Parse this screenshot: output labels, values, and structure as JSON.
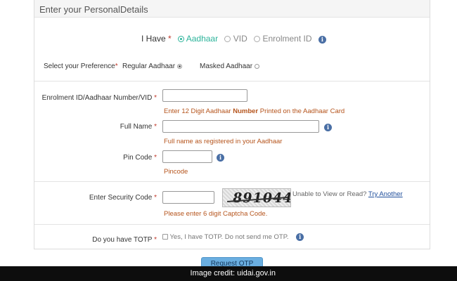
{
  "panel": {
    "title": "Enter your PersonalDetails"
  },
  "have": {
    "label": "I Have",
    "required": "*",
    "options": [
      {
        "label": "Aadhaar",
        "selected": true
      },
      {
        "label": "VID",
        "selected": false
      },
      {
        "label": "Enrolment ID",
        "selected": false
      }
    ]
  },
  "preference": {
    "label": "Select your Preference",
    "required": "*",
    "options": [
      {
        "label": "Regular Aadhaar",
        "selected": true
      },
      {
        "label": "Masked Aadhaar",
        "selected": false
      }
    ]
  },
  "id_field": {
    "label": "Enrolment ID/Aadhaar Number/VID",
    "required": "*",
    "value": "",
    "hint_before": "Enter 12 Digit Aadhaar ",
    "hint_bold": "Number",
    "hint_after": " Printed on the Aadhaar Card"
  },
  "name_field": {
    "label": "Full Name",
    "required": "*",
    "value": "",
    "hint": "Full name as registered in your Aadhaar"
  },
  "pin_field": {
    "label": "Pin Code",
    "required": "*",
    "value": "",
    "hint": "Pincode"
  },
  "security": {
    "label": "Enter Security Code",
    "required": "*",
    "value": "",
    "captcha_text": "891044",
    "unable_text": "Unable to View or Read?",
    "try_another": "Try Another",
    "hint": "Please enter 6 digit Captcha Code."
  },
  "totp": {
    "label": "Do you have TOTP",
    "required": "*",
    "checkbox_label": "Yes, I have TOTP. Do not send me OTP."
  },
  "request_button": "Request OTP",
  "credit": "Image credit: uidai.gov.in",
  "colors": {
    "accent": "#2bb39a",
    "hint": "#b5541c",
    "info": "#4a6fa5",
    "button": "#6aaee0"
  }
}
